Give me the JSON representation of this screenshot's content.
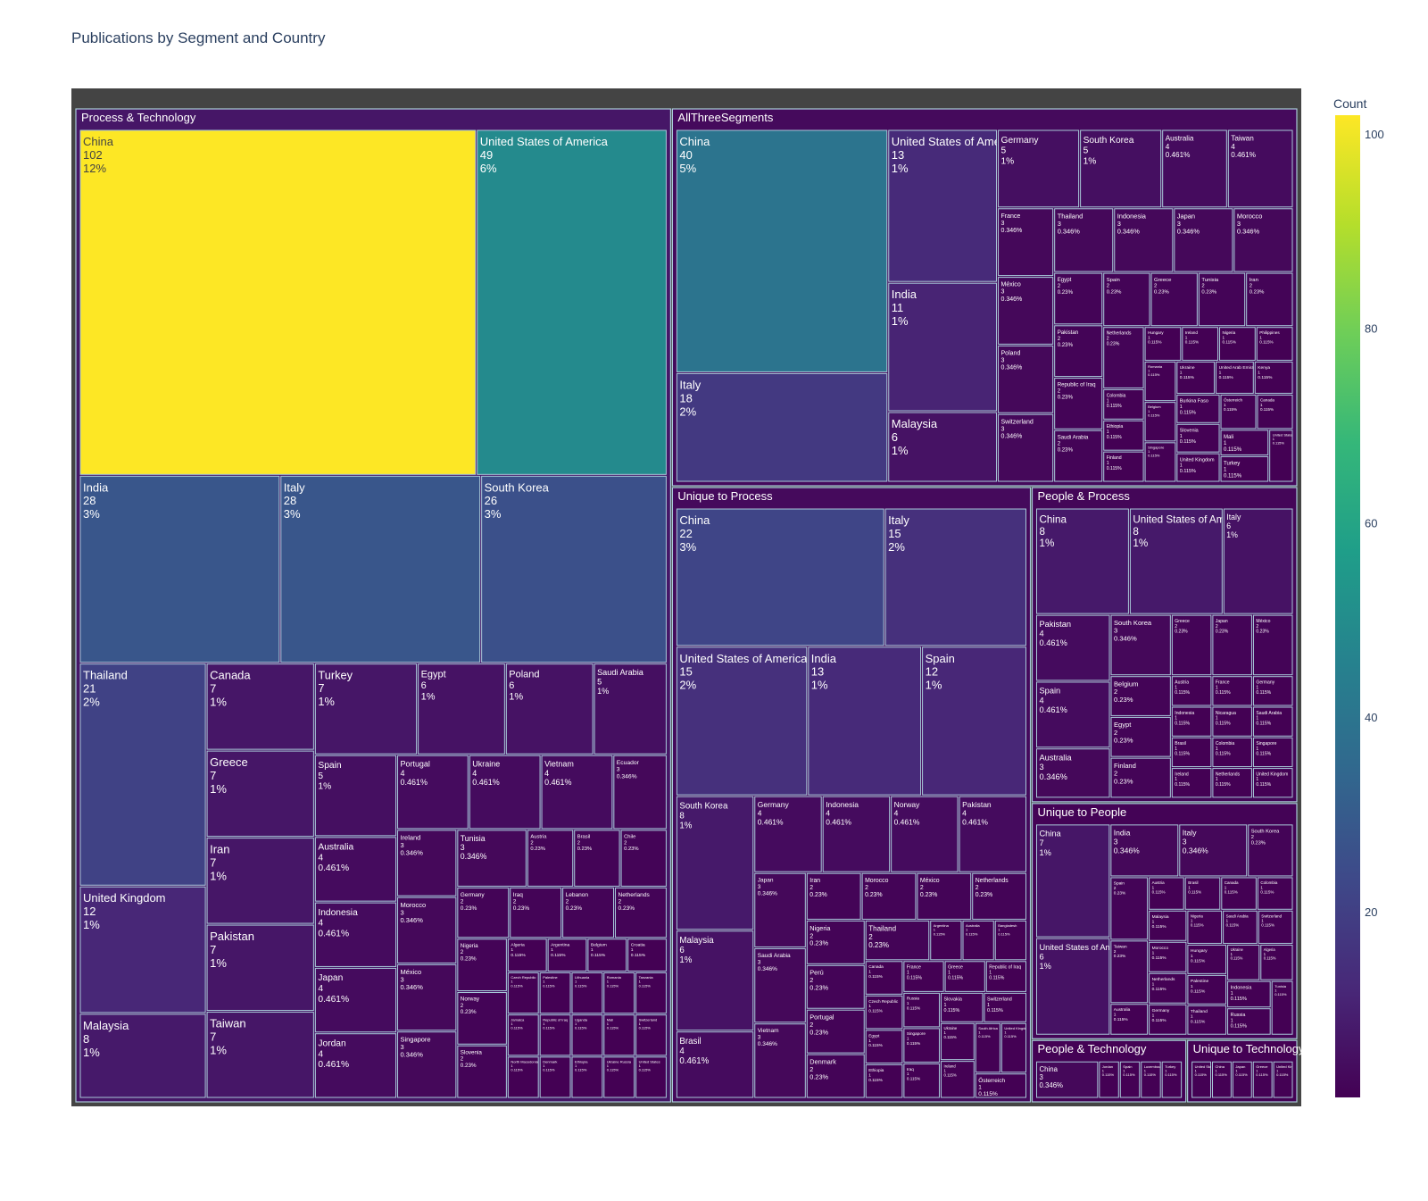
{
  "chart_data": {
    "type": "treemap",
    "title": "Publications by Segment and Country",
    "colorbar": {
      "title": "Count",
      "range": [
        1,
        102
      ],
      "ticks": [
        20,
        40,
        60,
        80,
        100
      ]
    },
    "colorscale": "viridis",
    "segments": [
      {
        "name": "Process & Technology",
        "items": [
          [
            "China",
            102,
            "12%"
          ],
          [
            "United States of America",
            49,
            "6%"
          ],
          [
            "India",
            28,
            "3%"
          ],
          [
            "Italy",
            28,
            "3%"
          ],
          [
            "South Korea",
            26,
            "3%"
          ],
          [
            "Thailand",
            21,
            "2%"
          ],
          [
            "United Kingdom",
            12,
            "1%"
          ],
          [
            "Malaysia",
            8,
            "1%"
          ],
          [
            "Canada",
            7,
            "1%"
          ],
          [
            "Greece",
            7,
            "1%"
          ],
          [
            "Iran",
            7,
            "1%"
          ],
          [
            "Pakistan",
            7,
            "1%"
          ],
          [
            "Taiwan",
            7,
            "1%"
          ],
          [
            "Turkey",
            7,
            "1%"
          ],
          [
            "Egypt",
            6,
            "1%"
          ],
          [
            "Poland",
            6,
            "1%"
          ],
          [
            "Saudi Arabia",
            5,
            "1%"
          ],
          [
            "Spain",
            5,
            "1%"
          ],
          [
            "Australia",
            4,
            "0.461%"
          ],
          [
            "Indonesia",
            4,
            "0.461%"
          ],
          [
            "Japan",
            4,
            "0.461%"
          ],
          [
            "Jordan",
            4,
            "0.461%"
          ],
          [
            "Portugal",
            4,
            "0.461%"
          ],
          [
            "Ukraine",
            4,
            "0.461%"
          ],
          [
            "Vietnam",
            4,
            "0.461%"
          ],
          [
            "Ecuador",
            3,
            "0.346%"
          ],
          [
            "Ireland",
            3,
            "0.346%"
          ],
          [
            "Morocco",
            3,
            "0.346%"
          ],
          [
            "México",
            3,
            "0.346%"
          ],
          [
            "Singapore",
            3,
            "0.346%"
          ],
          [
            "Tunisia",
            3,
            "0.346%"
          ],
          [
            "Austria",
            2,
            "0.23%"
          ],
          [
            "Brasil",
            2,
            "0.23%"
          ],
          [
            "Chile",
            2,
            "0.23%"
          ],
          [
            "Germany",
            2,
            "0.23%"
          ],
          [
            "Iraq",
            2,
            "0.23%"
          ],
          [
            "Lebanon",
            2,
            "0.23%"
          ],
          [
            "Netherlands",
            2,
            "0.23%"
          ],
          [
            "Nigeria",
            2,
            "0.23%"
          ],
          [
            "Norway",
            2,
            "0.23%"
          ],
          [
            "Slovenia",
            2,
            "0.23%"
          ],
          [
            "Algeria",
            1,
            "0.115%"
          ],
          [
            "Argentina",
            1,
            "0.115%"
          ],
          [
            "Belgium",
            1,
            "0.115%"
          ],
          [
            "Croatia",
            1,
            "0.115%"
          ],
          [
            "Czech Republic",
            1,
            "0.115%"
          ],
          [
            "Jamaica",
            1,
            "0.115%"
          ],
          [
            "North Macedonia",
            1,
            "0.115%"
          ],
          [
            "Palestine",
            1,
            "0.115%"
          ],
          [
            "Republic of Iraq",
            1,
            "0.115%"
          ],
          [
            "Denmark",
            1,
            "0.115%"
          ],
          [
            "Lithuania",
            1,
            "0.115%"
          ],
          [
            "Romania",
            1,
            "0.115%"
          ],
          [
            "Tanzania",
            1,
            "0.115%"
          ],
          [
            "Uganda",
            1,
            "0.115%"
          ],
          [
            "Ethiopia",
            1,
            "0.115%"
          ],
          [
            "Mali",
            1,
            "0.115%"
          ],
          [
            "Switzerland",
            1,
            "0.115%"
          ],
          [
            "Ukraine Russia",
            1,
            "0.115%"
          ],
          [
            "United States",
            1,
            "0.115%"
          ]
        ]
      },
      {
        "name": "AllThreeSegments",
        "items": [
          [
            "China",
            40,
            "5%"
          ],
          [
            "Italy",
            18,
            "2%"
          ],
          [
            "United States of America",
            13,
            "1%"
          ],
          [
            "India",
            11,
            "1%"
          ],
          [
            "Malaysia",
            6,
            "1%"
          ],
          [
            "Germany",
            5,
            "1%"
          ],
          [
            "South Korea",
            5,
            "1%"
          ],
          [
            "Australia",
            4,
            "0.461%"
          ],
          [
            "Taiwan",
            4,
            "0.461%"
          ],
          [
            "France",
            3,
            "0.346%"
          ],
          [
            "México",
            3,
            "0.346%"
          ],
          [
            "Poland",
            3,
            "0.346%"
          ],
          [
            "Switzerland",
            3,
            "0.346%"
          ],
          [
            "Thailand",
            3,
            "0.346%"
          ],
          [
            "Indonesia",
            3,
            "0.346%"
          ],
          [
            "Japan",
            3,
            "0.346%"
          ],
          [
            "Morocco",
            3,
            "0.346%"
          ],
          [
            "Egypt",
            2,
            "0.23%"
          ],
          [
            "Pakistan",
            2,
            "0.23%"
          ],
          [
            "Republic of Iraq",
            2,
            "0.23%"
          ],
          [
            "Saudi Arabia",
            2,
            "0.23%"
          ],
          [
            "Spain",
            2,
            "0.23%"
          ],
          [
            "Greece",
            2,
            "0.23%"
          ],
          [
            "Tunisia",
            2,
            "0.23%"
          ],
          [
            "Iran",
            2,
            "0.23%"
          ],
          [
            "Netherlands",
            2,
            "0.23%"
          ],
          [
            "Colombia",
            1,
            "0.115%"
          ],
          [
            "Ethiopia",
            1,
            "0.115%"
          ],
          [
            "Finland",
            1,
            "0.115%"
          ],
          [
            "Hungary",
            1,
            "0.115%"
          ],
          [
            "Ireland",
            1,
            "0.115%"
          ],
          [
            "Nigeria",
            1,
            "0.115%"
          ],
          [
            "Philippines",
            1,
            "0.115%"
          ],
          [
            "Romania",
            1,
            "0.115%"
          ],
          [
            "Belgium",
            1,
            "0.115%"
          ],
          [
            "Singapore",
            1,
            "0.115%"
          ],
          [
            "Ukraine",
            1,
            "0.115%"
          ],
          [
            "United Arab Emirates",
            1,
            "0.115%"
          ],
          [
            "Kenya",
            1,
            "0.115%"
          ],
          [
            "Burkina Faso",
            1,
            "0.115%"
          ],
          [
            "Slovenia",
            1,
            "0.115%"
          ],
          [
            "United Kingdom",
            1,
            "0.115%"
          ],
          [
            "Österreich",
            1,
            "0.115%"
          ],
          [
            "Canada",
            1,
            "0.115%"
          ],
          [
            "Mali",
            1,
            "0.115%"
          ],
          [
            "Turkey",
            1,
            "0.115%"
          ],
          [
            "United States",
            1,
            "0.115%"
          ]
        ]
      },
      {
        "name": "Unique to Process",
        "items": [
          [
            "China",
            22,
            "3%"
          ],
          [
            "Italy",
            15,
            "2%"
          ],
          [
            "United States of America",
            15,
            "2%"
          ],
          [
            "India",
            13,
            "1%"
          ],
          [
            "Spain",
            12,
            "1%"
          ],
          [
            "South Korea",
            8,
            "1%"
          ],
          [
            "Malaysia",
            6,
            "1%"
          ],
          [
            "Brasil",
            4,
            "0.461%"
          ],
          [
            "Germany",
            4,
            "0.461%"
          ],
          [
            "Indonesia",
            4,
            "0.461%"
          ],
          [
            "Norway",
            4,
            "0.461%"
          ],
          [
            "Pakistan",
            4,
            "0.461%"
          ],
          [
            "Japan",
            3,
            "0.346%"
          ],
          [
            "Saudi Arabia",
            3,
            "0.346%"
          ],
          [
            "Vietnam",
            3,
            "0.346%"
          ],
          [
            "Iran",
            2,
            "0.23%"
          ],
          [
            "Morocco",
            2,
            "0.23%"
          ],
          [
            "México",
            2,
            "0.23%"
          ],
          [
            "Netherlands",
            2,
            "0.23%"
          ],
          [
            "Nigeria",
            2,
            "0.23%"
          ],
          [
            "Perú",
            2,
            "0.23%"
          ],
          [
            "Portugal",
            2,
            "0.23%"
          ],
          [
            "Denmark",
            2,
            "0.23%"
          ],
          [
            "Thailand",
            2,
            "0.23%"
          ],
          [
            "Argentina",
            1,
            "0.115%"
          ],
          [
            "Australia",
            1,
            "0.115%"
          ],
          [
            "Bangladesh",
            1,
            "0.115%"
          ],
          [
            "Canada",
            1,
            "0.115%"
          ],
          [
            "Czech Republic",
            1,
            "0.115%"
          ],
          [
            "Egypt",
            1,
            "0.115%"
          ],
          [
            "Ethiopia",
            1,
            "0.115%"
          ],
          [
            "France",
            1,
            "0.115%"
          ],
          [
            "Greece",
            1,
            "0.115%"
          ],
          [
            "Republic of Iraq",
            1,
            "0.115%"
          ],
          [
            "Russia",
            1,
            "0.115%"
          ],
          [
            "Singapore",
            1,
            "0.115%"
          ],
          [
            "Iraq",
            1,
            "0.115%"
          ],
          [
            "Slovakia",
            1,
            "0.115%"
          ],
          [
            "Switzerland",
            1,
            "0.115%"
          ],
          [
            "Ukraine",
            1,
            "0.115%"
          ],
          [
            "Ireland",
            1,
            "0.115%"
          ],
          [
            "South Africa",
            1,
            "0.115%"
          ],
          [
            "United Kingdom",
            1,
            "0.115%"
          ],
          [
            "Österreich",
            1,
            "0.115%"
          ]
        ]
      },
      {
        "name": "People & Process",
        "items": [
          [
            "China",
            8,
            "1%"
          ],
          [
            "United States of America",
            8,
            "1%"
          ],
          [
            "Italy",
            6,
            "1%"
          ],
          [
            "Pakistan",
            4,
            "0.461%"
          ],
          [
            "Spain",
            4,
            "0.461%"
          ],
          [
            "Australia",
            3,
            "0.346%"
          ],
          [
            "South Korea",
            3,
            "0.346%"
          ],
          [
            "Greece",
            2,
            "0.23%"
          ],
          [
            "Japan",
            2,
            "0.23%"
          ],
          [
            "México",
            2,
            "0.23%"
          ],
          [
            "Belgium",
            2,
            "0.23%"
          ],
          [
            "Egypt",
            2,
            "0.23%"
          ],
          [
            "Finland",
            2,
            "0.23%"
          ],
          [
            "Austria",
            1,
            "0.115%"
          ],
          [
            "France",
            1,
            "0.115%"
          ],
          [
            "Germany",
            1,
            "0.115%"
          ],
          [
            "Indonesia",
            1,
            "0.115%"
          ],
          [
            "Brasil",
            1,
            "0.115%"
          ],
          [
            "Ireland",
            1,
            "0.115%"
          ],
          [
            "Nicaragua",
            1,
            "0.115%"
          ],
          [
            "Saudi Arabia",
            1,
            "0.115%"
          ],
          [
            "Colombia",
            1,
            "0.115%"
          ],
          [
            "Netherlands",
            1,
            "0.115%"
          ],
          [
            "Singapore",
            1,
            "0.115%"
          ],
          [
            "United Kingdom",
            1,
            "0.115%"
          ]
        ]
      },
      {
        "name": "Unique to People",
        "items": [
          [
            "China",
            7,
            "1%"
          ],
          [
            "United States of America",
            6,
            "1%"
          ],
          [
            "India",
            3,
            "0.346%"
          ],
          [
            "Italy",
            3,
            "0.346%"
          ],
          [
            "South Korea",
            2,
            "0.23%"
          ],
          [
            "Spain",
            2,
            "0.23%"
          ],
          [
            "Taiwan",
            2,
            "0.23%"
          ],
          [
            "Australia",
            1,
            "0.115%"
          ],
          [
            "Austria",
            1,
            "0.115%"
          ],
          [
            "Brasil",
            1,
            "0.115%"
          ],
          [
            "Canada",
            1,
            "0.115%"
          ],
          [
            "Colombia",
            1,
            "0.115%"
          ],
          [
            "Malaysia",
            1,
            "0.115%"
          ],
          [
            "Morocco",
            1,
            "0.115%"
          ],
          [
            "Netherlands",
            1,
            "0.115%"
          ],
          [
            "Germany",
            1,
            "0.115%"
          ],
          [
            "Nigeria",
            1,
            "0.115%"
          ],
          [
            "Saudi Arabia",
            1,
            "0.115%"
          ],
          [
            "Switzerland",
            1,
            "0.115%"
          ],
          [
            "Hungary",
            1,
            "0.115%"
          ],
          [
            "Palestine",
            1,
            "0.115%"
          ],
          [
            "Thailand",
            1,
            "0.115%"
          ],
          [
            "Ukraine",
            1,
            "0.115%"
          ],
          [
            "Algeria",
            1,
            "0.115%"
          ],
          [
            "Indonesia",
            1,
            "0.115%"
          ],
          [
            "Russia",
            1,
            "0.115%"
          ],
          [
            "Tunisia",
            1,
            "0.115%"
          ]
        ]
      },
      {
        "name": "People & Technology",
        "items": [
          [
            "China",
            3,
            "0.346%"
          ],
          [
            "Jordan",
            1,
            "0.115%"
          ],
          [
            "Spain",
            1,
            "0.115%"
          ],
          [
            "Luxembourg",
            1,
            "0.115%"
          ],
          [
            "Turkey",
            1,
            "0.115%"
          ]
        ]
      },
      {
        "name": "Unique to Technology",
        "items": [
          [
            "United States of America",
            1,
            "0.115%"
          ],
          [
            "China",
            1,
            "0.115%"
          ],
          [
            "Japan",
            1,
            "0.115%"
          ],
          [
            "Greece",
            1,
            "0.115%"
          ],
          [
            "United Kingdom",
            1,
            "0.115%"
          ]
        ]
      }
    ]
  }
}
